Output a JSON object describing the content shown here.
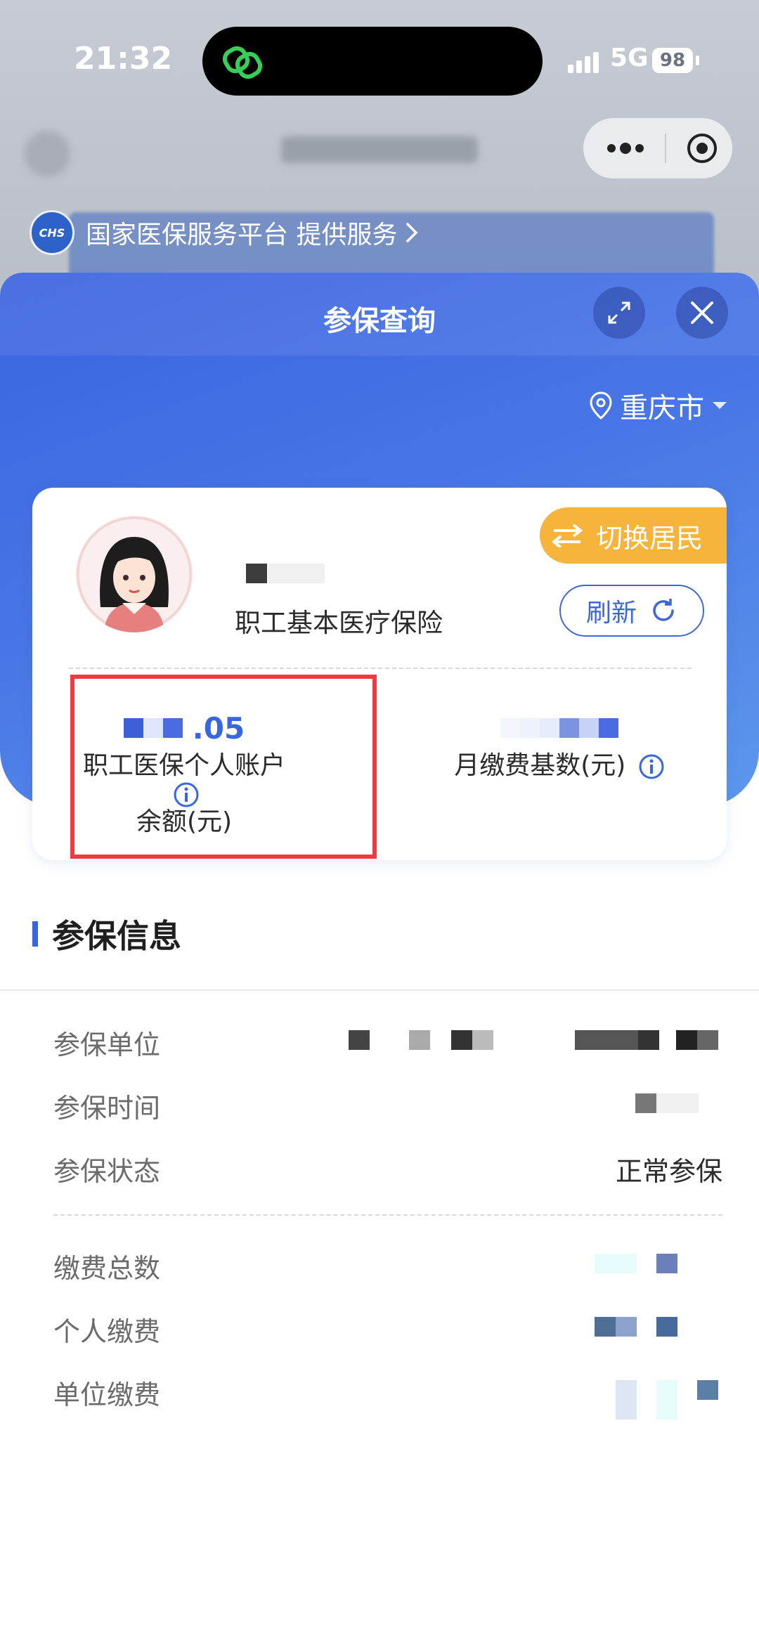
{
  "status_bar": {
    "time": "21:32",
    "network": "5G",
    "battery": "98"
  },
  "provider": {
    "logo_text": "CHS",
    "text": "国家医保服务平台 提供服务"
  },
  "sheet": {
    "title": "参保查询",
    "location": "重庆市"
  },
  "card": {
    "insurance_type": "职工基本医疗保险",
    "switch_label": "切换居民",
    "refresh_label": "刷新",
    "account_balance_value_visible": ".05",
    "account_balance_label_line1": "职工医保个人账户",
    "account_balance_label_line2": "余额(元)",
    "monthly_base_label": "月缴费基数(元)"
  },
  "info": {
    "section_title": "参保信息",
    "rows": [
      {
        "label": "参保单位"
      },
      {
        "label": "参保时间"
      },
      {
        "label": "参保状态",
        "value": "正常参保"
      },
      {
        "label": "缴费总数"
      },
      {
        "label": "个人缴费"
      },
      {
        "label": "单位缴费"
      }
    ]
  },
  "colors": {
    "primary": "#3866e0",
    "accent_orange": "#f6b53a",
    "highlight_red": "#ee3b42"
  }
}
